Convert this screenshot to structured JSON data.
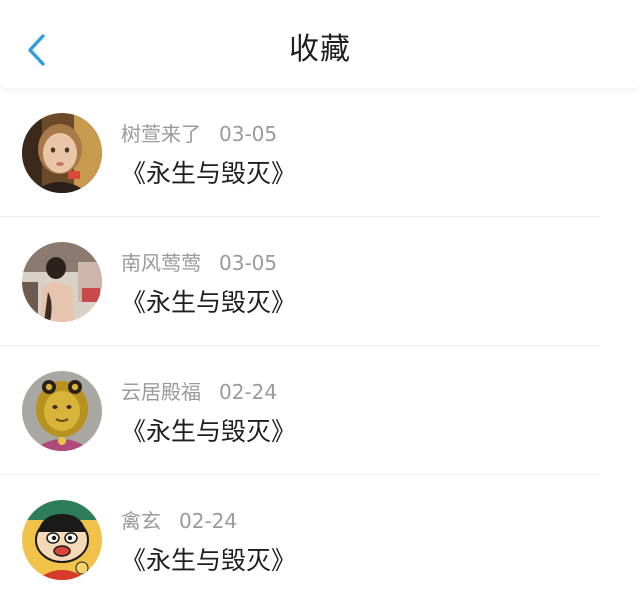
{
  "header": {
    "title": "收藏",
    "back_icon": "chevron-left-icon",
    "accent_color": "#2f9de4"
  },
  "items": [
    {
      "name": "树萱来了",
      "date": "03-05",
      "content": "《永生与毁灭》",
      "avatar": "toddler-photo-avatar"
    },
    {
      "name": "南风莺莺",
      "date": "03-05",
      "content": "《永生与毁灭》",
      "avatar": "woman-photo-avatar"
    },
    {
      "name": "云居殿福",
      "date": "02-24",
      "content": "《永生与毁灭》",
      "avatar": "golden-lion-avatar"
    },
    {
      "name": "禽玄",
      "date": "02-24",
      "content": "《永生与毁灭》",
      "avatar": "cartoon-boy-avatar"
    }
  ]
}
